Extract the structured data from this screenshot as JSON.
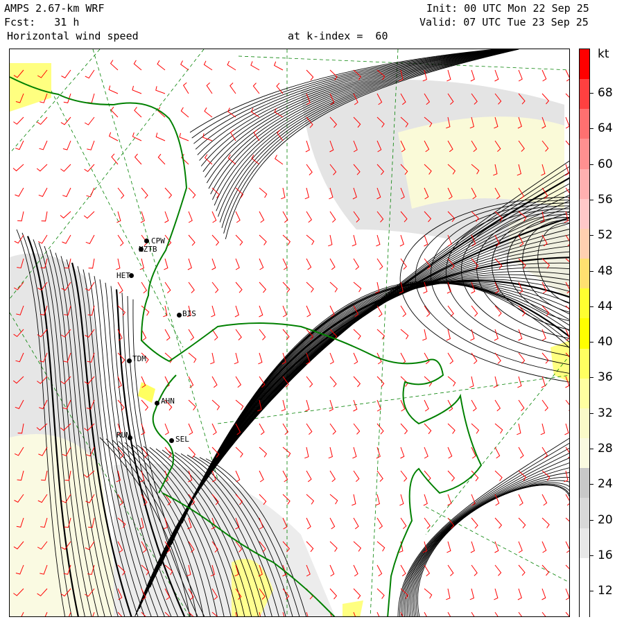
{
  "header": {
    "model": "AMPS 2.67-km WRF",
    "fcst": "Fcst:   31 h",
    "field": "Horizontal wind speed",
    "level": "at k-index =  60",
    "init": "Init: 00 UTC Mon 22 Sep 25",
    "valid": "Valid: 07 UTC Tue 23 Sep 25"
  },
  "colorbar": {
    "unit": "kt",
    "labels": [
      "68",
      "64",
      "60",
      "56",
      "52",
      "48",
      "44",
      "40",
      "36",
      "32",
      "28",
      "24",
      "20",
      "16",
      "12"
    ],
    "colors": [
      "#ffffff",
      "#ffffff",
      "#e8e8e8",
      "#d8d8d8",
      "#c8c8c8",
      "#fafae0",
      "#fafac8",
      "#ffffa0",
      "#ffff60",
      "#ffff00",
      "#ffff30",
      "#ffe070",
      "#ffd0b0",
      "#ffc8c8",
      "#ffb0b0",
      "#ff9090",
      "#ff7070",
      "#ff4040",
      "#ff0000"
    ]
  },
  "stations": [
    {
      "code": "CPW"
    },
    {
      "code": "NZTB"
    },
    {
      "code": "HET"
    },
    {
      "code": "BIS"
    },
    {
      "code": "TDM"
    },
    {
      "code": "AHN"
    },
    {
      "code": "RUN"
    },
    {
      "code": "SEL"
    }
  ],
  "colors": {
    "coast": "#008000",
    "barbs": "#ff0000",
    "grid": "#008000",
    "streamlines": "#000000"
  }
}
